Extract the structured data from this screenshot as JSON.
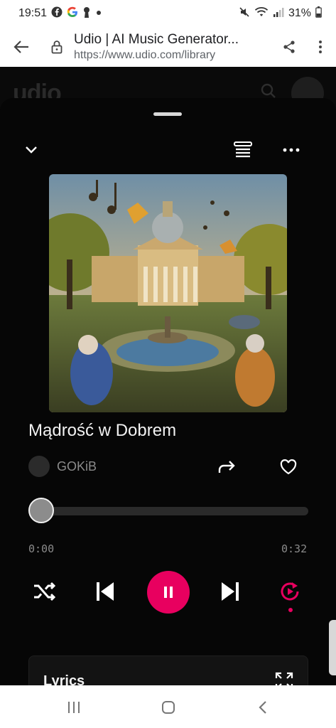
{
  "status_bar": {
    "time": "19:51",
    "battery": "31%"
  },
  "browser": {
    "page_title": "Udio | AI Music Generator...",
    "url": "https://www.udio.com/library"
  },
  "site": {
    "logo": "udio"
  },
  "player": {
    "song_title": "Mądrość w Dobrem",
    "artist": "GOKiB",
    "time_current": "0:00",
    "time_total": "0:32",
    "progress": 0.0,
    "lyrics_label": "Lyrics"
  },
  "colors": {
    "accent": "#e8005f",
    "background": "#060606",
    "text_muted": "#8a8a8a"
  },
  "icons": {
    "status": [
      "facebook-icon",
      "google-icon",
      "keyhole-icon",
      "dot-icon",
      "mute-icon",
      "wifi-icon",
      "signal-icon",
      "battery-icon"
    ],
    "browser": [
      "back-arrow-icon",
      "lock-icon",
      "share-icon",
      "more-vert-icon"
    ],
    "player": [
      "chevron-down-icon",
      "queue-icon",
      "more-horiz-icon",
      "share-arrow-icon",
      "heart-icon",
      "shuffle-icon",
      "skip-previous-icon",
      "pause-icon",
      "skip-next-icon",
      "repeat-icon",
      "expand-icon"
    ],
    "nav": [
      "recents-icon",
      "home-icon",
      "back-chevron-icon"
    ]
  }
}
